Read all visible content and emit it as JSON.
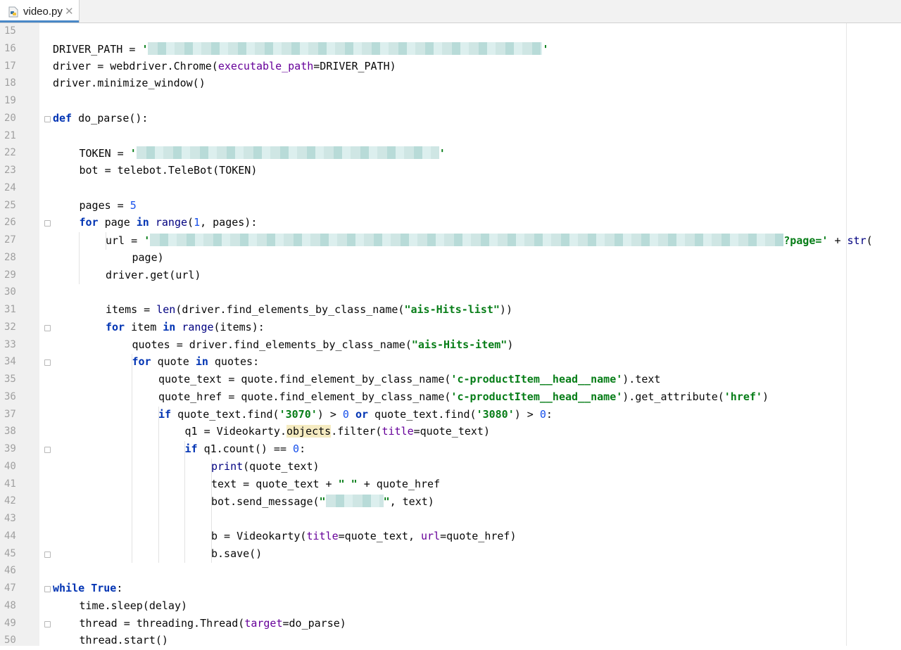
{
  "tab": {
    "filename": "video.py",
    "close": "✕",
    "icon": "python-file-icon"
  },
  "colors": {
    "keyword": "#0033b3",
    "string": "#067d17",
    "number": "#1750eb",
    "param": "#660099",
    "gutter": "#f0f0f0"
  },
  "lines": [
    {
      "n": "15",
      "i": 0,
      "segs": []
    },
    {
      "n": "16",
      "i": 0,
      "segs": [
        {
          "t": "DRIVER_PATH = ",
          "c": "plain"
        },
        {
          "t": "'",
          "c": "str"
        },
        {
          "blur": 560
        },
        {
          "t": "'",
          "c": "str"
        }
      ]
    },
    {
      "n": "17",
      "i": 0,
      "segs": [
        {
          "t": "driver = webdriver.Chrome(",
          "c": "plain"
        },
        {
          "t": "executable_path",
          "c": "param"
        },
        {
          "t": "=DRIVER_PATH)",
          "c": "plain"
        }
      ]
    },
    {
      "n": "18",
      "i": 0,
      "segs": [
        {
          "t": "driver.minimize_window()",
          "c": "plain"
        }
      ]
    },
    {
      "n": "19",
      "i": 0,
      "segs": []
    },
    {
      "n": "20",
      "i": 0,
      "segs": [
        {
          "t": "def",
          "c": "kw"
        },
        {
          "t": " do_parse():",
          "c": "plain"
        }
      ]
    },
    {
      "n": "21",
      "i": 0,
      "segs": []
    },
    {
      "n": "22",
      "i": 1,
      "segs": [
        {
          "t": "TOKEN = ",
          "c": "plain"
        },
        {
          "t": "'",
          "c": "str"
        },
        {
          "blur": 430
        },
        {
          "t": "'",
          "c": "str"
        }
      ]
    },
    {
      "n": "23",
      "i": 1,
      "segs": [
        {
          "t": "bot = telebot.TeleBot(TOKEN)",
          "c": "plain"
        }
      ]
    },
    {
      "n": "24",
      "i": 0,
      "segs": []
    },
    {
      "n": "25",
      "i": 1,
      "segs": [
        {
          "t": "pages = ",
          "c": "plain"
        },
        {
          "t": "5",
          "c": "num"
        }
      ]
    },
    {
      "n": "26",
      "i": 1,
      "segs": [
        {
          "t": "for",
          "c": "kw"
        },
        {
          "t": " page ",
          "c": "plain"
        },
        {
          "t": "in",
          "c": "kw"
        },
        {
          "t": " ",
          "c": "plain"
        },
        {
          "t": "range",
          "c": "builtin"
        },
        {
          "t": "(",
          "c": "plain"
        },
        {
          "t": "1",
          "c": "num"
        },
        {
          "t": ", pages):",
          "c": "plain"
        }
      ]
    },
    {
      "n": "27",
      "i": 2,
      "segs": [
        {
          "t": "url = ",
          "c": "plain"
        },
        {
          "t": "'",
          "c": "str"
        },
        {
          "blur": 900
        },
        {
          "t": "?page='",
          "c": "str"
        },
        {
          "t": " + ",
          "c": "plain"
        },
        {
          "t": "str",
          "c": "builtin"
        },
        {
          "t": "(",
          "c": "plain"
        }
      ]
    },
    {
      "n": "28",
      "i": 3,
      "segs": [
        {
          "t": "page)",
          "c": "plain"
        }
      ]
    },
    {
      "n": "29",
      "i": 2,
      "segs": [
        {
          "t": "driver.get(url)",
          "c": "plain"
        }
      ]
    },
    {
      "n": "30",
      "i": 0,
      "segs": []
    },
    {
      "n": "31",
      "i": 2,
      "segs": [
        {
          "t": "items = ",
          "c": "plain"
        },
        {
          "t": "len",
          "c": "builtin"
        },
        {
          "t": "(driver.find_elements_by_class_name(",
          "c": "plain"
        },
        {
          "t": "\"ais-Hits-list\"",
          "c": "str"
        },
        {
          "t": "))",
          "c": "plain"
        }
      ]
    },
    {
      "n": "32",
      "i": 2,
      "segs": [
        {
          "t": "for",
          "c": "kw"
        },
        {
          "t": " item ",
          "c": "plain"
        },
        {
          "t": "in",
          "c": "kw"
        },
        {
          "t": " ",
          "c": "plain"
        },
        {
          "t": "range",
          "c": "builtin"
        },
        {
          "t": "(items):",
          "c": "plain"
        }
      ]
    },
    {
      "n": "33",
      "i": 3,
      "segs": [
        {
          "t": "quotes = driver.find_elements_by_class_name(",
          "c": "plain"
        },
        {
          "t": "\"ais-Hits-item\"",
          "c": "str"
        },
        {
          "t": ")",
          "c": "plain"
        }
      ]
    },
    {
      "n": "34",
      "i": 3,
      "segs": [
        {
          "t": "for",
          "c": "kw"
        },
        {
          "t": " quote ",
          "c": "plain"
        },
        {
          "t": "in",
          "c": "kw"
        },
        {
          "t": " quotes:",
          "c": "plain"
        }
      ]
    },
    {
      "n": "35",
      "i": 4,
      "segs": [
        {
          "t": "quote_text = quote.find_element_by_class_name(",
          "c": "plain"
        },
        {
          "t": "'c-productItem__head__name'",
          "c": "str"
        },
        {
          "t": ").text",
          "c": "plain"
        }
      ]
    },
    {
      "n": "36",
      "i": 4,
      "segs": [
        {
          "t": "quote_href = quote.find_element_by_class_name(",
          "c": "plain"
        },
        {
          "t": "'c-productItem__head__name'",
          "c": "str"
        },
        {
          "t": ").get_attribute(",
          "c": "plain"
        },
        {
          "t": "'href'",
          "c": "str"
        },
        {
          "t": ")",
          "c": "plain"
        }
      ]
    },
    {
      "n": "37",
      "i": 4,
      "segs": [
        {
          "t": "if",
          "c": "kw"
        },
        {
          "t": " quote_text.find(",
          "c": "plain"
        },
        {
          "t": "'3070'",
          "c": "str"
        },
        {
          "t": ") > ",
          "c": "plain"
        },
        {
          "t": "0",
          "c": "num"
        },
        {
          "t": " ",
          "c": "plain"
        },
        {
          "t": "or",
          "c": "kw"
        },
        {
          "t": " quote_text.find(",
          "c": "plain"
        },
        {
          "t": "'3080'",
          "c": "str"
        },
        {
          "t": ") > ",
          "c": "plain"
        },
        {
          "t": "0",
          "c": "num"
        },
        {
          "t": ":",
          "c": "plain"
        }
      ]
    },
    {
      "n": "38",
      "i": 5,
      "segs": [
        {
          "t": "q1 = Videokarty.",
          "c": "plain"
        },
        {
          "t": "objects",
          "c": "highlight"
        },
        {
          "t": ".filter(",
          "c": "plain"
        },
        {
          "t": "title",
          "c": "param"
        },
        {
          "t": "=quote_text)",
          "c": "plain"
        }
      ]
    },
    {
      "n": "39",
      "i": 5,
      "segs": [
        {
          "t": "if",
          "c": "kw"
        },
        {
          "t": " q1.count() == ",
          "c": "plain"
        },
        {
          "t": "0",
          "c": "num"
        },
        {
          "t": ":",
          "c": "plain"
        }
      ]
    },
    {
      "n": "40",
      "i": 6,
      "segs": [
        {
          "t": "print",
          "c": "builtin"
        },
        {
          "t": "(quote_text)",
          "c": "plain"
        }
      ]
    },
    {
      "n": "41",
      "i": 6,
      "segs": [
        {
          "t": "text = quote_text + ",
          "c": "plain"
        },
        {
          "t": "\" \"",
          "c": "str"
        },
        {
          "t": " + quote_href",
          "c": "plain"
        }
      ]
    },
    {
      "n": "42",
      "i": 6,
      "segs": [
        {
          "t": "bot.send_message(",
          "c": "plain"
        },
        {
          "t": "\"",
          "c": "str"
        },
        {
          "blur": 82
        },
        {
          "t": "\"",
          "c": "str"
        },
        {
          "t": ", text)",
          "c": "plain"
        }
      ]
    },
    {
      "n": "43",
      "i": 0,
      "segs": []
    },
    {
      "n": "44",
      "i": 6,
      "segs": [
        {
          "t": "b = Videokarty(",
          "c": "plain"
        },
        {
          "t": "title",
          "c": "param"
        },
        {
          "t": "=quote_text, ",
          "c": "plain"
        },
        {
          "t": "url",
          "c": "param"
        },
        {
          "t": "=quote_href)",
          "c": "plain"
        }
      ]
    },
    {
      "n": "45",
      "i": 6,
      "segs": [
        {
          "t": "b.save()",
          "c": "plain"
        }
      ]
    },
    {
      "n": "46",
      "i": 0,
      "segs": []
    },
    {
      "n": "47",
      "i": 0,
      "segs": [
        {
          "t": "while",
          "c": "kw"
        },
        {
          "t": " ",
          "c": "plain"
        },
        {
          "t": "True",
          "c": "kw"
        },
        {
          "t": ":",
          "c": "plain"
        }
      ]
    },
    {
      "n": "48",
      "i": 1,
      "segs": [
        {
          "t": "time.sleep(delay)",
          "c": "plain"
        }
      ]
    },
    {
      "n": "49",
      "i": 1,
      "segs": [
        {
          "t": "thread = threading.Thread(",
          "c": "plain"
        },
        {
          "t": "target",
          "c": "param"
        },
        {
          "t": "=do_parse)",
          "c": "plain"
        }
      ]
    },
    {
      "n": "50",
      "i": 1,
      "segs": [
        {
          "t": "thread.start()",
          "c": "plain"
        }
      ]
    }
  ]
}
